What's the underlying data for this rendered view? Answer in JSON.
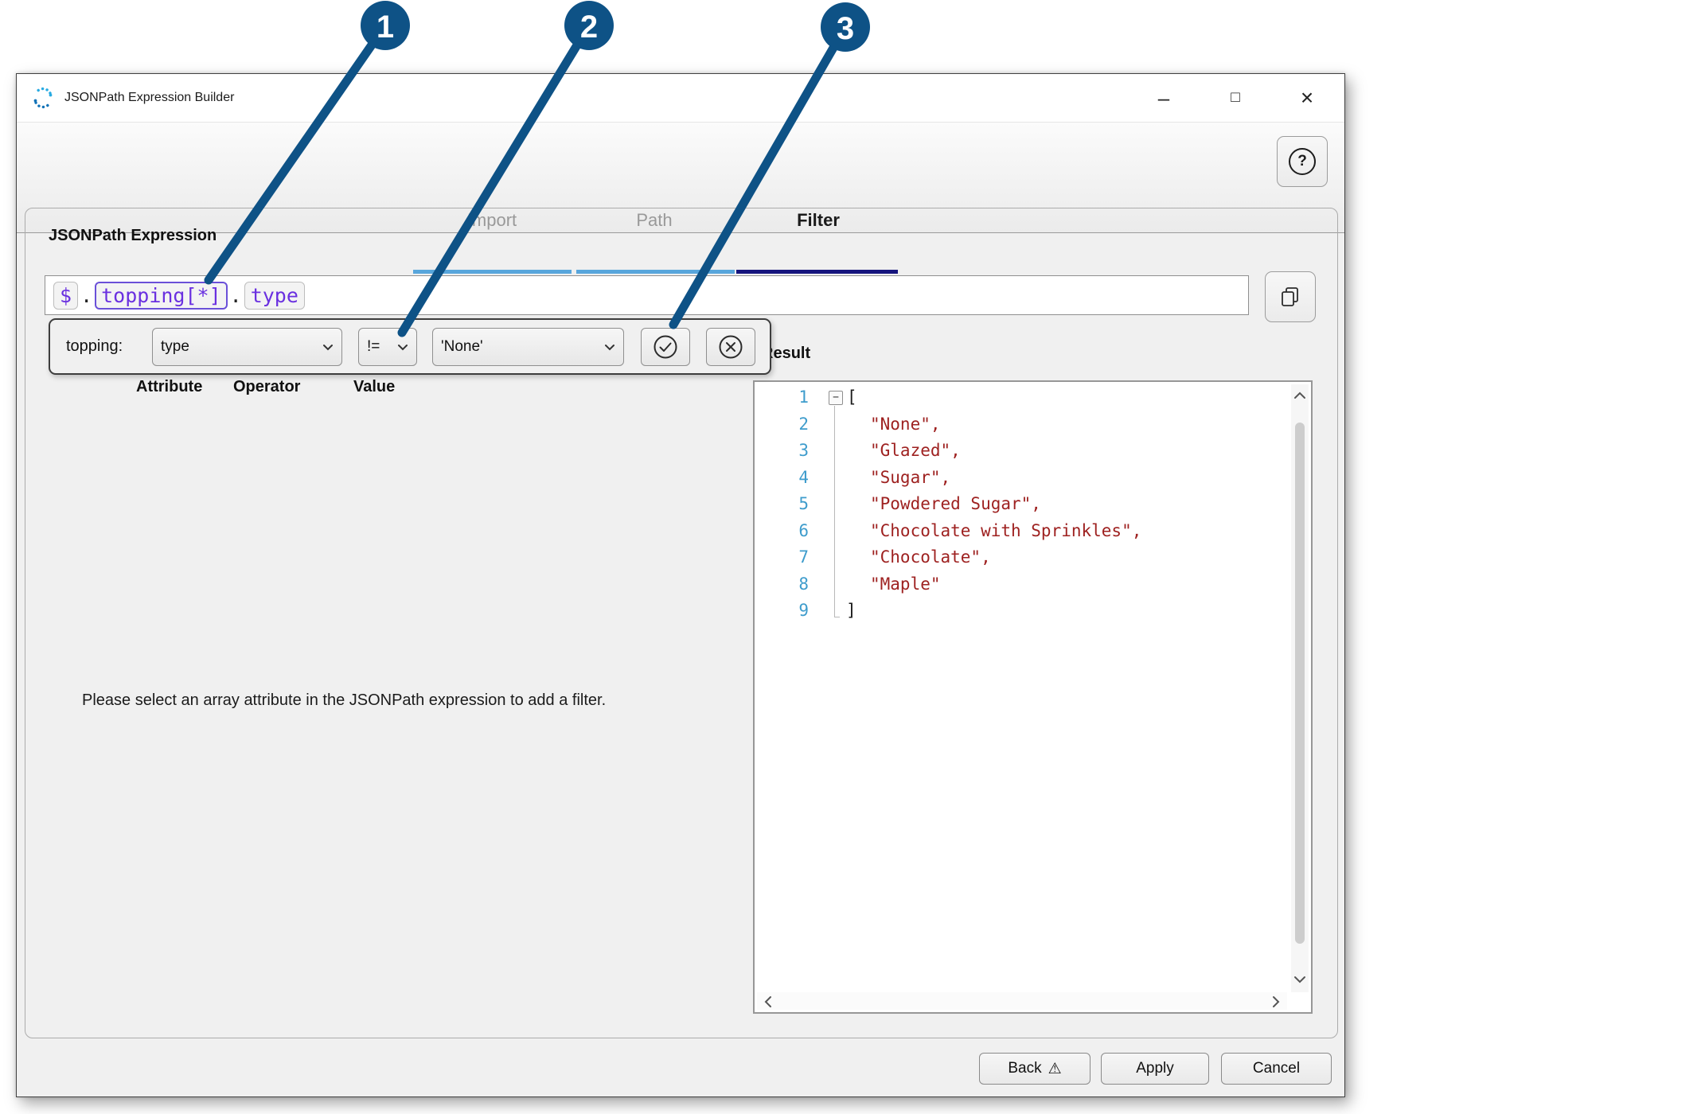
{
  "window": {
    "title": "JSONPath Expression Builder",
    "controls": {
      "minimize": "–",
      "maximize": "□",
      "close": "×"
    }
  },
  "header": {
    "tabs": [
      {
        "label": "Import"
      },
      {
        "label": "Path"
      },
      {
        "label": "Filter"
      }
    ],
    "active_tab": "Filter",
    "help_glyph": "?"
  },
  "expression_section": {
    "label": "JSONPath Expression",
    "tokens": {
      "root": "$",
      "dot1": ".",
      "array": "topping[*]",
      "dot2": ".",
      "field": "type"
    }
  },
  "filter_popup": {
    "prefix_label": "topping:",
    "attribute_value": "type",
    "operator_value": "!=",
    "value_value": "'None'"
  },
  "filter_columns": {
    "attribute": "Attribute",
    "operator": "Operator",
    "value": "Value"
  },
  "result": {
    "label": "Result",
    "fold_glyph": "−",
    "lines": [
      {
        "n": "1",
        "code": "["
      },
      {
        "n": "2",
        "code": "\"None\","
      },
      {
        "n": "3",
        "code": "\"Glazed\","
      },
      {
        "n": "4",
        "code": "\"Sugar\","
      },
      {
        "n": "5",
        "code": "\"Powdered Sugar\","
      },
      {
        "n": "6",
        "code": "\"Chocolate with Sprinkles\","
      },
      {
        "n": "7",
        "code": "\"Chocolate\","
      },
      {
        "n": "8",
        "code": "\"Maple\""
      },
      {
        "n": "9",
        "code": "]"
      }
    ]
  },
  "message": "Please select an array attribute in the JSONPath expression to add a filter.",
  "footer": {
    "back_label": "Back",
    "back_warning_glyph": "⚠",
    "apply_label": "Apply",
    "cancel_label": "Cancel"
  },
  "callouts": [
    {
      "number": "1"
    },
    {
      "number": "2"
    },
    {
      "number": "3"
    }
  ],
  "colors": {
    "callout_blue": "#0e5286",
    "tab_underline_blue": "#58a6dc",
    "tab_underline_navy": "#16157d",
    "expression_purple": "#6a30e0",
    "string_red": "#9e2120",
    "line_number_blue": "#3e9ccc"
  }
}
